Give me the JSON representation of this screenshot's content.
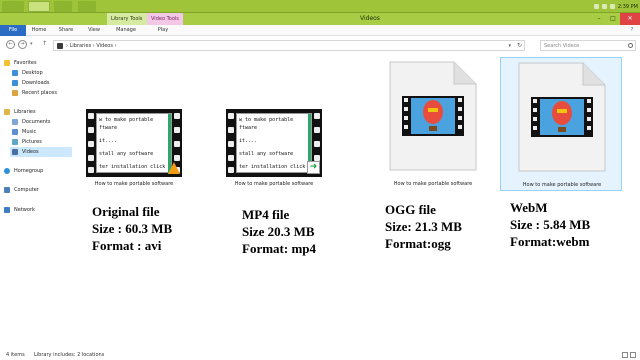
{
  "taskbar": {
    "clock": "2:39 PM"
  },
  "window": {
    "title": "Videos"
  },
  "context_tabs": {
    "library_tools": "Library Tools",
    "video_tools": "Video Tools"
  },
  "ribbon": {
    "file": "File",
    "home": "Home",
    "share": "Share",
    "view": "View",
    "manage": "Manage",
    "play": "Play",
    "help": "?"
  },
  "address": {
    "path": "› Libraries › Videos ›",
    "search_placeholder": "Search Videos"
  },
  "nav": {
    "favorites": "Favorites",
    "desktop": "Desktop",
    "downloads": "Downloads",
    "recent": "Recent places",
    "libraries": "Libraries",
    "documents": "Documents",
    "music": "Music",
    "pictures": "Pictures",
    "videos": "Videos",
    "homegroup": "Homegroup",
    "computer": "Computer",
    "network": "Network"
  },
  "thumb_text": [
    "w to make portable",
    "ftware",
    "it....",
    "stall any software",
    "ter installation click on"
  ],
  "files": [
    {
      "caption": "How to make portable software",
      "kind": "avi"
    },
    {
      "caption": "How to make portable software",
      "kind": "mp4"
    },
    {
      "caption": "How to make portable software",
      "kind": "ogg"
    },
    {
      "caption": "How to make portable software",
      "kind": "webm"
    }
  ],
  "annotations": [
    {
      "line1": "Original file",
      "line2": "Size : 60.3 MB",
      "line3": "Format : avi"
    },
    {
      "line1": "MP4 file",
      "line2": "Size 20.3 MB",
      "line3": "Format: mp4"
    },
    {
      "line1": "OGG file",
      "line2": "Size: 21.3 MB",
      "line3": "Format:ogg"
    },
    {
      "line1": "WebM",
      "line2": "Size : 5.84 MB",
      "line3": "Format:webm"
    }
  ],
  "status": {
    "items": "4 items",
    "library": "Library includes: 2 locations"
  },
  "colors": {
    "taskbar": "#9fc43a",
    "file_tab": "#2b6cc4",
    "selection": "#cce8ff"
  }
}
